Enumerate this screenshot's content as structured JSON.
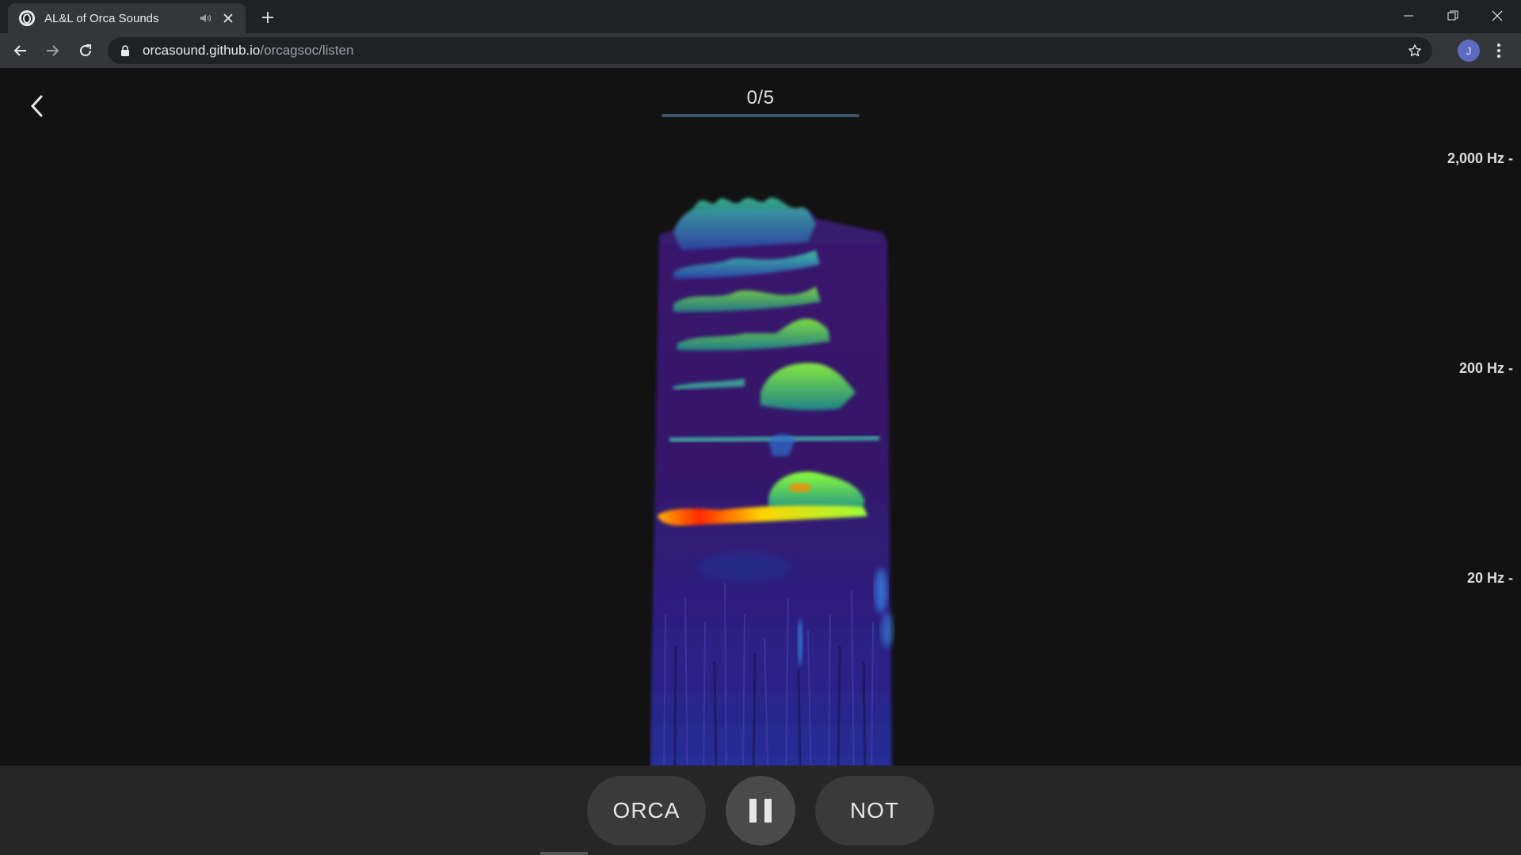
{
  "browser": {
    "tab_title": "AL&L of Orca Sounds",
    "url_host": "orcasound.github.io",
    "url_path": "/orcagsoc/listen",
    "avatar_initial": "J"
  },
  "progress": {
    "label": "0/5",
    "fraction": 0
  },
  "spectrogram": {
    "frequency_labels": [
      "2,000 Hz -",
      "200 Hz -",
      "20 Hz -"
    ]
  },
  "controls": {
    "orca_label": "ORCA",
    "not_label": "NOT",
    "state": "playing"
  },
  "colors": {
    "background": "#121212",
    "control_bar": "#262626",
    "pill": "#3a3a3a",
    "progress_track": "#3b5368"
  },
  "icons": [
    "back-chevron-icon",
    "pause-icon",
    "lock-icon",
    "star-icon",
    "reload-icon",
    "audio-icon",
    "close-icon"
  ]
}
